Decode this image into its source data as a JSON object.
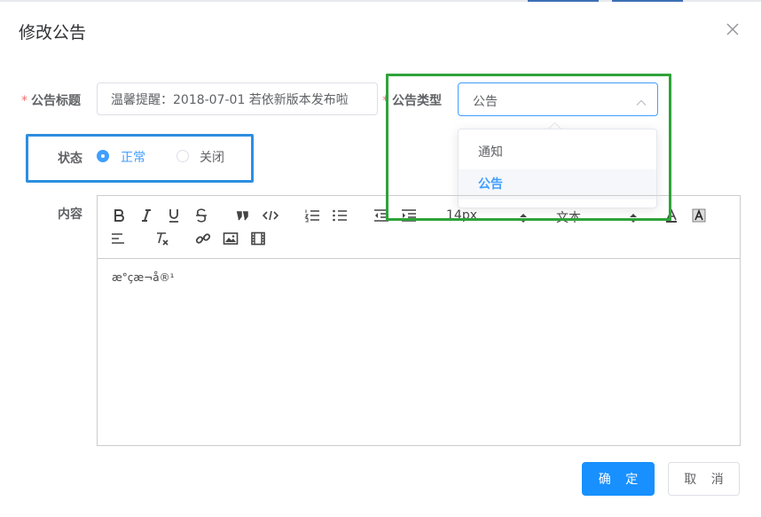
{
  "dialog": {
    "title": "修改公告"
  },
  "form": {
    "title_label": "公告标题",
    "title_value": "温馨提醒：2018-07-01 若依新版本发布啦",
    "type_label": "公告类型",
    "type_value": "公告",
    "type_options": [
      "通知",
      "公告"
    ],
    "status_label": "状态",
    "status_options": [
      "正常",
      "关闭"
    ],
    "status_selected": "正常",
    "content_label": "内容",
    "required_mark": "*"
  },
  "editor": {
    "font_size": "14px",
    "text_style": "文本",
    "content": "æ°çæ¬å®¹"
  },
  "footer": {
    "confirm_label": "确 定",
    "cancel_label": "取 消"
  },
  "colors": {
    "primary": "#1890ff",
    "accent": "#409eff",
    "required": "#f56c6c",
    "highlight_green": "#2fa33a",
    "highlight_blue": "#2d8ee0"
  },
  "icons": [
    "close-icon",
    "chevron-up-icon",
    "bold-icon",
    "italic-icon",
    "underline-icon",
    "strike-icon",
    "blockquote-icon",
    "code-block-icon",
    "ordered-list-icon",
    "bullet-list-icon",
    "outdent-icon",
    "indent-icon",
    "color-icon",
    "background-icon",
    "align-icon",
    "clean-icon",
    "link-icon",
    "image-icon",
    "video-icon"
  ]
}
